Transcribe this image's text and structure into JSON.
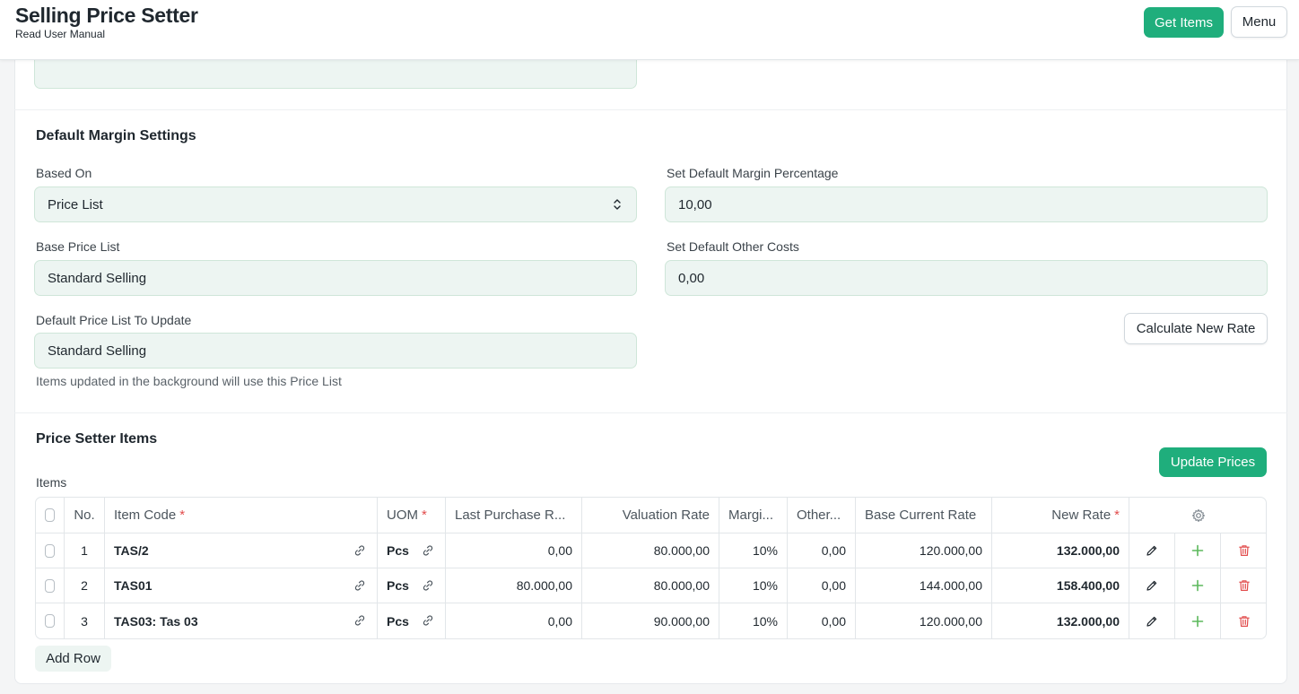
{
  "header": {
    "title": "Selling Price Setter",
    "subtitle": "Read User Manual",
    "get_items_label": "Get Items",
    "menu_label": "Menu"
  },
  "top_field": {
    "value": ""
  },
  "margin_settings": {
    "title": "Default Margin Settings",
    "based_on_label": "Based On",
    "based_on_value": "Price List",
    "margin_pct_label": "Set Default Margin Percentage",
    "margin_pct_value": "10,00",
    "base_price_list_label": "Base Price List",
    "base_price_list_value": "Standard Selling",
    "other_costs_label": "Set Default Other Costs",
    "other_costs_value": "0,00",
    "price_list_update_label": "Default Price List To Update",
    "price_list_update_value": "Standard Selling",
    "price_list_update_desc": "Items updated in the background will use this Price List",
    "calculate_label": "Calculate New Rate"
  },
  "items_section": {
    "title": "Price Setter Items",
    "update_prices_label": "Update Prices",
    "items_label": "Items",
    "columns": {
      "no": "No.",
      "item_code": "Item Code",
      "uom": "UOM",
      "last_purchase": "Last Purchase R...",
      "valuation": "Valuation Rate",
      "margin": "Margi...",
      "other": "Other...",
      "base_current": "Base Current Rate",
      "new_rate": "New Rate"
    },
    "required_mark": "*",
    "rows": [
      {
        "no": "1",
        "item_code": "TAS/2",
        "uom": "Pcs",
        "last_purchase": "0,00",
        "valuation": "80.000,00",
        "margin": "10%",
        "other": "0,00",
        "base_current": "120.000,00",
        "new_rate": "132.000,00"
      },
      {
        "no": "2",
        "item_code": "TAS01",
        "uom": "Pcs",
        "last_purchase": "80.000,00",
        "valuation": "80.000,00",
        "margin": "10%",
        "other": "0,00",
        "base_current": "144.000,00",
        "new_rate": "158.400,00"
      },
      {
        "no": "3",
        "item_code": "TAS03: Tas 03",
        "uom": "Pcs",
        "last_purchase": "0,00",
        "valuation": "90.000,00",
        "margin": "10%",
        "other": "0,00",
        "base_current": "120.000,00",
        "new_rate": "132.000,00"
      }
    ],
    "add_row_label": "Add Row"
  },
  "colors": {
    "primary": "#1fae7c",
    "field_bg": "#edf5f2",
    "delete": "#e24c4c",
    "add": "#5cb85c"
  }
}
